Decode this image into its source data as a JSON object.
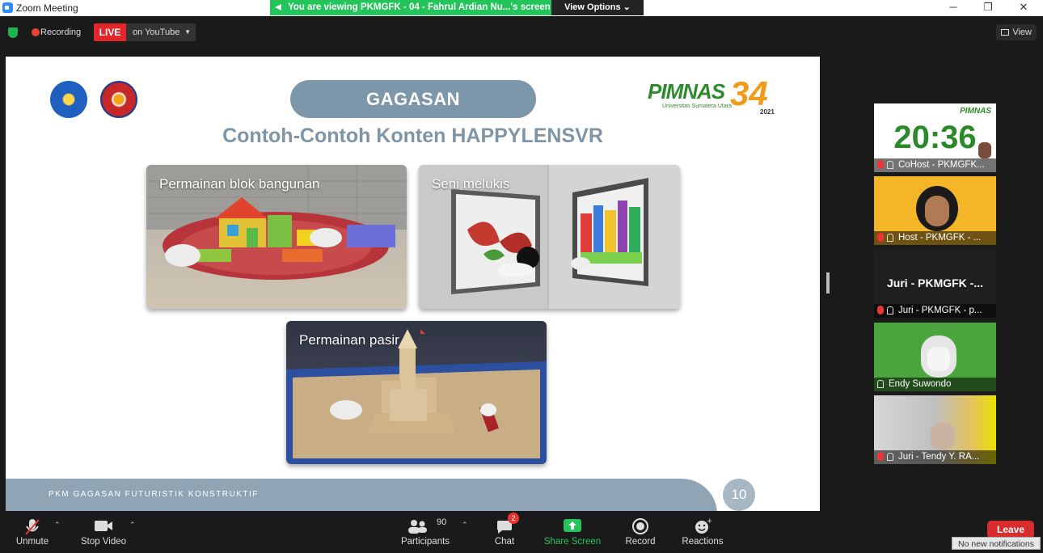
{
  "window": {
    "title": "Zoom Meeting",
    "minimize": "─",
    "maximize": "❐",
    "close": "✕"
  },
  "share_banner": {
    "text": "You are viewing PKMGFK - 04 - Fahrul Ardian Nu...'s screen",
    "view_options": "View Options"
  },
  "top_bar": {
    "recording": "Recording",
    "live": "LIVE",
    "stream_target": "on YouTube",
    "view": "View"
  },
  "slide": {
    "heading": "GAGASAN",
    "subtitle": "Contoh-Contoh Konten HAPPYLENSVR",
    "pimnas": {
      "word": "PIMNAS",
      "number": "34",
      "sub": "Universitas Sumatera Utara",
      "year": "2021"
    },
    "cards": [
      {
        "label": "Permainan blok bangunan"
      },
      {
        "label": "Seni melukis"
      },
      {
        "label": "Permainan pasir"
      }
    ],
    "footer": "PKM GAGASAN FUTURISTIK KONSTRUKTIF",
    "page_number": "10"
  },
  "gallery": [
    {
      "caption": "CoHost - PKMGFK...",
      "clock": "20:36",
      "muted": true
    },
    {
      "caption": "Host - PKMGFK - ...",
      "muted": true
    },
    {
      "caption": "Juri - PKMGFK - p...",
      "name": "Juri - PKMGFK -...",
      "muted": true
    },
    {
      "caption": "Endy Suwondo",
      "muted": false
    },
    {
      "caption": "Juri - Tendy Y. RA...",
      "muted": true
    }
  ],
  "toolbar": {
    "unmute": "Unmute",
    "stop_video": "Stop Video",
    "participants": "Participants",
    "participants_count": "90",
    "chat": "Chat",
    "chat_badge": "2",
    "share_screen": "Share Screen",
    "record": "Record",
    "reactions": "Reactions",
    "leave": "Leave",
    "notifications": "No new notifications"
  },
  "colors": {
    "share_green": "#23c45a",
    "live_red": "#e4262a",
    "slide_accent": "#7c96aa",
    "leave_red": "#d92c2c"
  }
}
